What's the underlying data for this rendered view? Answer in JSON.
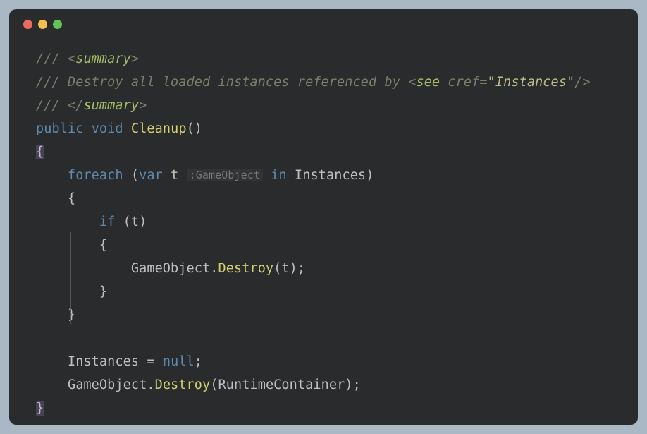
{
  "c1_slash": "///",
  "c1_open_angle": " <",
  "c1_tag": "summary",
  "c1_close_angle": ">",
  "c2_slash": "///",
  "c2_text": " Destroy all loaded instances referenced by ",
  "c2_open_angle": "<",
  "c2_see": "see",
  "c2_sp": " ",
  "c2_cref": "cref",
  "c2_eq": "=",
  "c2_q1": "\"",
  "c2_val": "Instances",
  "c2_q2": "\"",
  "c2_close": "/>",
  "c3_slash": "///",
  "c3_open_angle": " </",
  "c3_tag": "summary",
  "c3_close_angle": ">",
  "sig_public": "public",
  "sig_void": "void",
  "sig_method": "Cleanup",
  "sig_parens": "()",
  "brace_open1": "{",
  "foreach": "foreach",
  "var": "var",
  "tvar": "t",
  "hint_prefix": ":",
  "hint_type": "GameObject",
  "in": "in",
  "instances": "Instances",
  "rparen_foreach": ")",
  "brace_open2": "{",
  "if": "if",
  "tvar2": "t",
  "brace_open3": "{",
  "gameobject": "GameObject",
  "dot": ".",
  "destroy": "Destroy",
  "tvar3": "t",
  "semi": ";",
  "brace_close3": "}",
  "brace_close2": "}",
  "instances2": "Instances",
  "eq": " = ",
  "null": "null",
  "semi2": ";",
  "gameobject2": "GameObject",
  "destroy2": "Destroy",
  "rtc": "RuntimeContainer",
  "semi3": ";",
  "brace_close1": "}"
}
